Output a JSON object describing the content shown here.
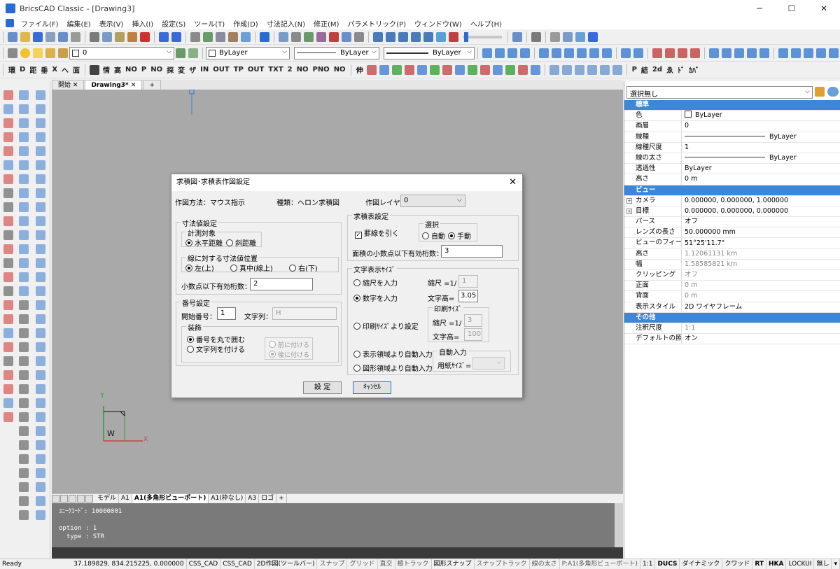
{
  "window": {
    "title": "BricsCAD Classic - [Drawing3]",
    "minimize": "─",
    "maximize": "☐",
    "close": "✕"
  },
  "menu": [
    "ファイル(F)",
    "編集(E)",
    "表示(V)",
    "挿入(I)",
    "設定(S)",
    "ツール(T)",
    "作成(D)",
    "寸法記入(N)",
    "修正(M)",
    "パラメトリック(P)",
    "ウィンドウ(W)",
    "ヘルプ(H)"
  ],
  "toolbar2": {
    "layer_value": "0",
    "color_value": "ByLayer",
    "linetype_value": "ByLayer",
    "lineweight_value": "ByLayer"
  },
  "toolbar3_labels": [
    "環",
    "D",
    "距",
    "垂",
    "X",
    "へ",
    "面",
    "情",
    "高",
    "NO",
    "P",
    "NO",
    "探",
    "変",
    "ザ",
    "IN",
    "OUT",
    "TP",
    "OUT",
    "TXT",
    "2",
    "NO",
    "PNO",
    "NO",
    "伸",
    "P",
    "結",
    "2d",
    "ゑ",
    "ﾄﾞ",
    "ｶﾊﾞ"
  ],
  "doc_tabs": {
    "tab1": "開始",
    "tab2": "Drawing3*",
    "add": "+"
  },
  "layout_tabs": [
    "モデル",
    "A1",
    "A1(多角形ビューポート)",
    "A1(枠なし)",
    "A3",
    "ロゴ",
    "+"
  ],
  "command_line": [
    "ﾕﾆｰｸｺｰﾄﾞ: 10000001",
    "",
    "option : 1",
    "  type : STR"
  ],
  "status": {
    "ready": "Ready",
    "coords": "37.189829, 834.215225, 0.000000",
    "items": [
      "CSS_CAD",
      "CSS_CAD",
      "2D作図(ツールバー)",
      "スナップ",
      "グリッド",
      "直交",
      "極トラック",
      "図形スナップ",
      "スナップトラック",
      "線の太さ",
      "P:A1(多角形ビューポート)",
      "1:1",
      "DUCS",
      "ダイナミック",
      "クワッド",
      "RT",
      "HKA",
      "LOCKUI",
      "無し",
      "▾"
    ]
  },
  "properties": {
    "selection": "選択無し",
    "rows": [
      {
        "type": "head",
        "key": "標準"
      },
      {
        "key": "色",
        "value": "ByLayer",
        "swatch": true
      },
      {
        "key": "画層",
        "value": "0"
      },
      {
        "key": "線種",
        "value": "ByLayer",
        "line": true
      },
      {
        "key": "線種尺度",
        "value": "1"
      },
      {
        "key": "線の太さ",
        "value": "ByLayer",
        "line": true
      },
      {
        "key": "透過性",
        "value": "ByLayer"
      },
      {
        "key": "高さ",
        "value": "0 m"
      },
      {
        "type": "head",
        "key": "ビュー"
      },
      {
        "key": "カメラ",
        "value": "0.000000, 0.000000, 1.000000",
        "plus": true
      },
      {
        "key": "目標",
        "value": "0.000000, 0.000000, 0.000000",
        "plus": true
      },
      {
        "key": "パース",
        "value": "オフ"
      },
      {
        "key": "レンズの長さ",
        "value": "50.000000 mm"
      },
      {
        "key": "ビューのフィールド",
        "value": "51°25'11.7\""
      },
      {
        "key": "高さ",
        "value": "1.12061131 km",
        "dim": true
      },
      {
        "key": "幅",
        "value": "1.58585821 km",
        "dim": true
      },
      {
        "key": "クリッピング",
        "value": "オフ",
        "dim": true
      },
      {
        "key": "正面",
        "value": "0 m",
        "dim": true
      },
      {
        "key": "背面",
        "value": "0 m",
        "dim": true
      },
      {
        "key": "表示スタイル",
        "value": "2D ワイヤフレーム"
      },
      {
        "type": "head",
        "key": "その他"
      },
      {
        "key": "注釈尺度",
        "value": "1:1",
        "dim": true
      },
      {
        "key": "デフォルトの照明",
        "value": "オン"
      }
    ]
  },
  "dialog": {
    "title": "求積図･求積表作図設定",
    "close": "✕",
    "method_label": "作図方法：マウス指示",
    "kind_label": "種類：ヘロン求積図",
    "layer_label": "作図レイヤ：",
    "layer_value": "0",
    "dim_group": "寸法値設定",
    "measure_group": "計測対象",
    "measure_opt1": "水平距離",
    "measure_opt2": "斜距離",
    "pos_group": "線に対する寸法値位置",
    "pos_opt1": "左(上)",
    "pos_opt2": "真中(線上)",
    "pos_opt3": "右(下)",
    "decimal_label": "小数点以下有効桁数：",
    "decimal_value": "2",
    "number_group": "番号設定",
    "start_label": "開始番号：",
    "start_value": "1",
    "str_label": "文字列：",
    "str_value": "H",
    "deco_group": "装飾",
    "deco_opt1": "番号を丸で囲む",
    "deco_opt2": "文字列を付ける",
    "before_opt": "前に付ける",
    "after_opt": "後に付ける",
    "table_group": "求積表設定",
    "rule_label": "罫線を引く",
    "select_group": "選択",
    "auto_opt": "自動",
    "manual_opt": "手動",
    "area_decimal_label": "面積の小数点以下有効桁数：",
    "area_decimal_value": "3",
    "textsize_group": "文字表示ｻｲｽﾞ",
    "scale_opt": "縮尺を入力",
    "scale_label": "縮尺 =1/",
    "scale_value": "1",
    "num_opt": "数字を入力",
    "height_label": "文字高=",
    "height_value": "3.05",
    "print_opt": "印刷ｻｲｽﾞより設定",
    "print_group": "印刷ｻｲｽﾞ",
    "print_scale_label": "縮尺 =1/",
    "print_scale_value": "3",
    "print_height_label": "文字高=",
    "print_height_value": "100",
    "display_opt": "表示領域より自動入力",
    "figure_opt": "図形領域より自動入力",
    "autoinput_group": "自動入力",
    "paper_label": "用紙ｻｲｽﾞ=",
    "ok": "設 定",
    "cancel": "ｷｬﾝｾﾙ"
  },
  "ucs": {
    "y": "Y",
    "x": "X",
    "w": "W"
  },
  "colors": {
    "accent": "#3c87d9",
    "canvas": "#a9a9a9",
    "ucs_green": "#2e9e2e",
    "ucs_red": "#d04040"
  }
}
